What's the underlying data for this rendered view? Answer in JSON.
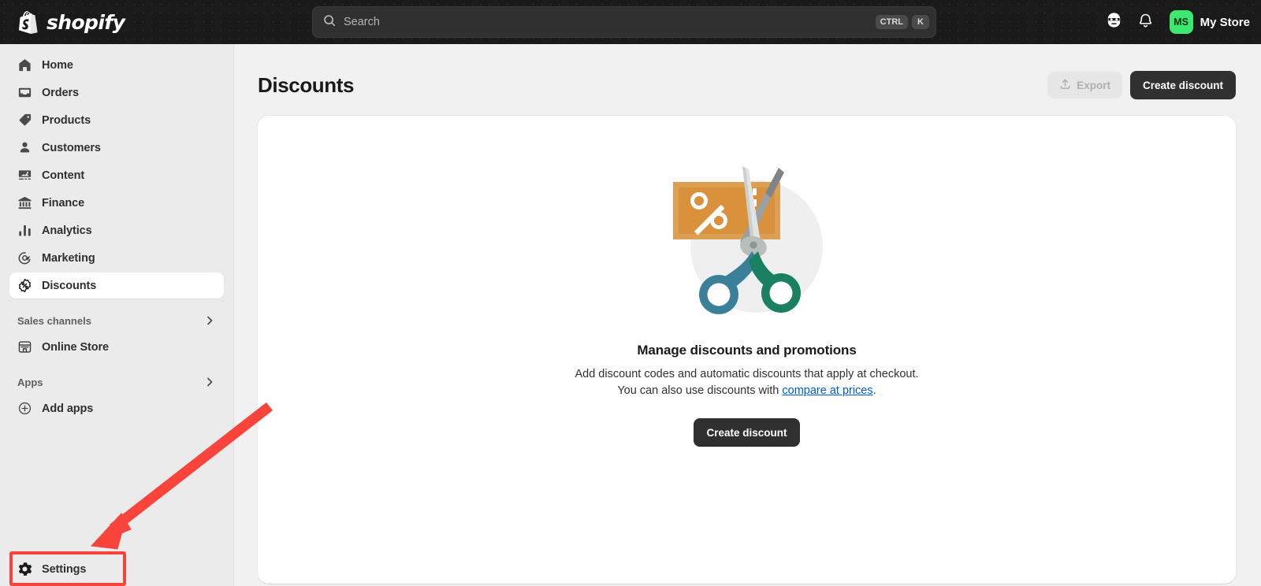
{
  "topbar": {
    "brand_name": "shopify",
    "brand_logo_icon": "shopify-bag-logo",
    "search": {
      "placeholder": "Search",
      "icon": "search-icon",
      "shortcut_modifier": "CTRL",
      "shortcut_key": "K"
    },
    "assistant_icon": "sidekick-face-icon",
    "notifications_icon": "bell-icon",
    "store": {
      "initials": "MS",
      "name": "My Store",
      "avatar_color": "#3CE870"
    }
  },
  "sidebar": {
    "items": [
      {
        "label": "Home",
        "icon": "home-icon",
        "active": false
      },
      {
        "label": "Orders",
        "icon": "orders-inbox-icon",
        "active": false
      },
      {
        "label": "Products",
        "icon": "product-tag-icon",
        "active": false
      },
      {
        "label": "Customers",
        "icon": "person-icon",
        "active": false
      },
      {
        "label": "Content",
        "icon": "image-content-icon",
        "active": false
      },
      {
        "label": "Finance",
        "icon": "bank-icon",
        "active": false
      },
      {
        "label": "Analytics",
        "icon": "bar-chart-icon",
        "active": false
      },
      {
        "label": "Marketing",
        "icon": "target-cursor-icon",
        "active": false
      },
      {
        "label": "Discounts",
        "icon": "discount-percent-icon",
        "active": true
      }
    ],
    "sections": [
      {
        "title": "Sales channels",
        "chevron_icon": "chevron-right-icon",
        "items": [
          {
            "label": "Online Store",
            "icon": "storefront-icon"
          }
        ]
      },
      {
        "title": "Apps",
        "chevron_icon": "chevron-right-icon",
        "items": [
          {
            "label": "Add apps",
            "icon": "plus-circle-icon"
          }
        ]
      }
    ],
    "settings": {
      "label": "Settings",
      "icon": "gear-icon",
      "highlight_color": "#F9443C"
    }
  },
  "annotation": {
    "arrow_color": "#F9443C",
    "points_to": "Settings"
  },
  "main": {
    "page_title": "Discounts",
    "export_button": {
      "label": "Export",
      "icon": "export-upload-icon",
      "disabled": true
    },
    "create_button_header": "Create discount",
    "empty_state": {
      "illustration": "discount-coupon-scissors-illustration",
      "title": "Manage discounts and promotions",
      "body_line1": "Add discount codes and automatic discounts that apply at checkout.",
      "body_line2_prefix": "You can also use discounts with ",
      "body_link": "compare at prices",
      "body_line2_suffix": ".",
      "cta_label": "Create discount"
    }
  },
  "colors": {
    "topbar_bg": "#1A1A1A",
    "sidebar_bg": "#EBEBEB",
    "main_bg": "#F1F1F1",
    "card_bg": "#FFFFFF",
    "primary_button": "#303030",
    "brand_green": "#3CE870",
    "link_blue": "#005BD3",
    "annotation_red": "#F9443C",
    "illustration_orange": "#D9923B",
    "illustration_teal": "#3B8099",
    "illustration_green": "#1A8060"
  }
}
